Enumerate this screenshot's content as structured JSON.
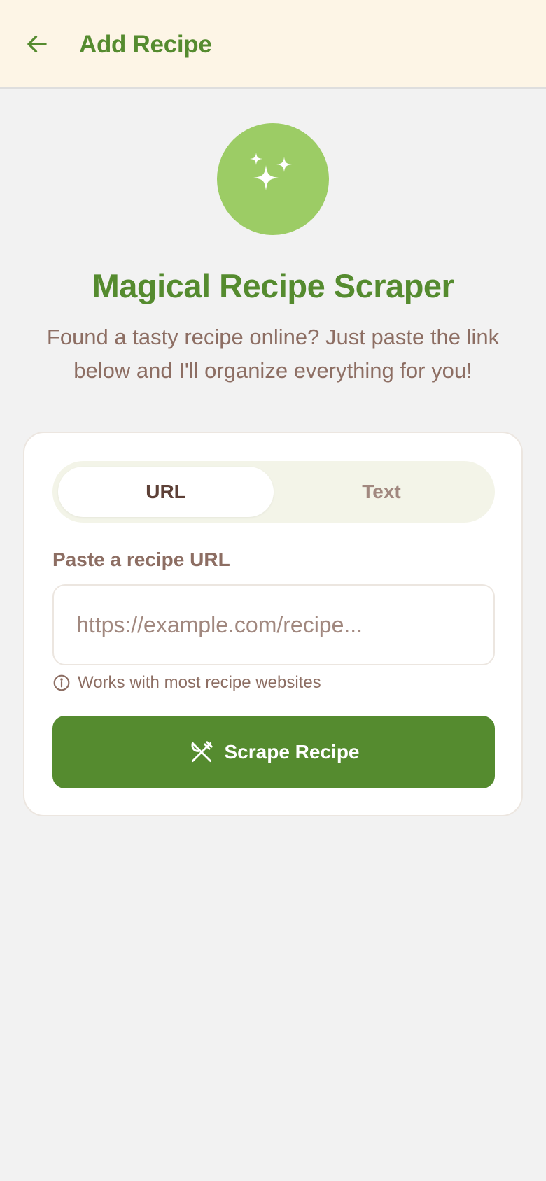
{
  "header": {
    "back_icon": "arrow-left-icon",
    "title": "Add Recipe"
  },
  "hero": {
    "icon": "sparkles-icon",
    "title": "Magical Recipe Scraper",
    "description": "Found a tasty recipe online? Just paste the link below and I'll organize everything for you!"
  },
  "form": {
    "tabs": [
      {
        "label": "URL",
        "selected": true
      },
      {
        "label": "Text",
        "selected": false
      }
    ],
    "field_label": "Paste a recipe URL",
    "url_value": "",
    "url_placeholder": "https://example.com/recipe...",
    "hint_icon": "info-circle-icon",
    "hint": "Works with most recipe websites",
    "submit_icon": "utensils-icon",
    "submit_label": "Scrape Recipe"
  },
  "colors": {
    "primary": "#558b2f",
    "accent_light": "#9ccc65",
    "header_bg": "#fdf5e6",
    "text_brown": "#8d6e63",
    "text_dark_brown": "#5d4037",
    "page_bg": "#f2f2f2"
  }
}
